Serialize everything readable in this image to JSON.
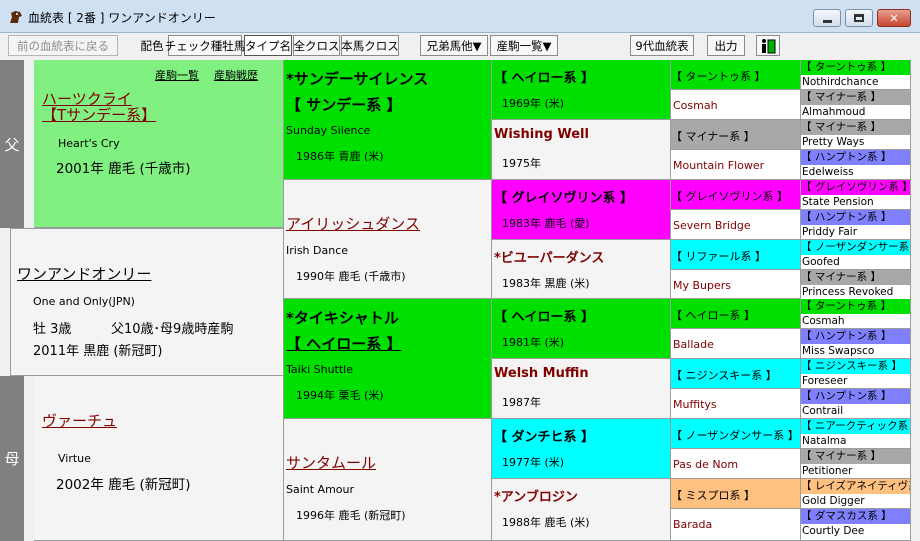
{
  "window": {
    "title": "血統表 [ 2番 ] ワンアンドオンリー"
  },
  "toolbar": {
    "back": "前の血統表に戻る",
    "color_label": "配色",
    "check_sire": "チェック種牡馬",
    "type_name": "タイプ名",
    "all_cross": "全クロス",
    "self_cross": "本馬クロス",
    "siblings": "兄弟馬他▼",
    "foals": "産駒一覧▼",
    "gen9": "9代血統表",
    "output": "出力"
  },
  "sections": {
    "father": "父",
    "mother": "母"
  },
  "sire": {
    "links": [
      "産駒一覧",
      "産駒戦歴"
    ],
    "name": "ハーツクライ",
    "line": "【Tサンデー系】",
    "eng": "Heart's Cry",
    "info": "2001年 鹿毛 (千歳市)"
  },
  "horse": {
    "name": "ワンアンドオンリー",
    "eng": "One and Only(JPN)",
    "detail1": "牡 3歳",
    "detail2": "父10歳･母9歳時産駒",
    "info": "2011年 黒鹿 (新冠町)"
  },
  "dam": {
    "name": "ヴァーチュ",
    "eng": "Virtue",
    "info": "2002年 鹿毛 (新冠町)"
  },
  "gen2": [
    {
      "name": "*サンデーサイレンス",
      "line": "【 サンデー系 】",
      "eng": "Sunday Silence",
      "info": "1986年 青鹿 (米)"
    },
    {
      "name": "アイリッシュダンス",
      "eng": "Irish Dance",
      "info": "1990年 鹿毛 (千歳市)"
    },
    {
      "name": "*タイキシャトル",
      "line": "【 ヘイロー系 】",
      "eng": "Taiki Shuttle",
      "info": "1994年 栗毛 (米)"
    },
    {
      "name": "サンタムール",
      "eng": "Saint Amour",
      "info": "1996年 鹿毛 (新冠町)"
    }
  ],
  "gen3": [
    {
      "line": "【 ヘイロー系 】",
      "info": "1969年 (米)"
    },
    {
      "name": "Wishing Well",
      "info": "1975年"
    },
    {
      "line": "【 グレイソヴリン系 】",
      "info": "1983年 鹿毛 (愛)"
    },
    {
      "name": "*ビユーパーダンス",
      "info": "1983年 黒鹿 (米)"
    },
    {
      "line": "【 ヘイロー系 】",
      "info": "1981年 (米)"
    },
    {
      "name": "Welsh Muffin",
      "info": "1987年"
    },
    {
      "line": "【 ダンチヒ系 】",
      "info": "1977年 (米)"
    },
    {
      "name": "*アンブロジン",
      "info": "1988年 鹿毛 (米)"
    }
  ],
  "gen4": [
    {
      "line": "【 ターントゥ系 】",
      "name": "Cosmah"
    },
    {
      "line": "【 マイナー系 】",
      "name": "Mountain Flower"
    },
    {
      "line": "【 グレイソヴリン系 】",
      "name": "Severn Bridge"
    },
    {
      "line": "【 リファール系 】",
      "name": "My Bupers"
    },
    {
      "line": "【 ヘイロー系 】",
      "name": "Ballade"
    },
    {
      "line": "【 ニジンスキー系 】",
      "name": "Muffitys"
    },
    {
      "line": "【 ノーザンダンサー系 】",
      "name": "Pas de Nom"
    },
    {
      "line": "【 ミスプロ系 】",
      "name": "Barada"
    }
  ],
  "gen5": [
    {
      "line": "【 ターントゥ系 】",
      "name": "Nothirdchance"
    },
    {
      "line": "【 マイナー系 】",
      "name": "Almahmoud"
    },
    {
      "line": "【 マイナー系 】",
      "name": "Pretty Ways"
    },
    {
      "line": "【 ハンプトン系 】",
      "name": "Edelweiss"
    },
    {
      "line": "【 グレイソヴリン系 】",
      "name": "State Pension"
    },
    {
      "line": "【 ハンプトン系 】",
      "name": "Priddy Fair"
    },
    {
      "line": "【 ノーザンダンサー系 】",
      "name": "Goofed"
    },
    {
      "line": "【 マイナー系 】",
      "name": "Princess Revoked"
    },
    {
      "line": "【 ターントゥ系 】",
      "name": "Cosmah"
    },
    {
      "line": "【 ハンプトン系 】",
      "name": "Miss Swapsco"
    },
    {
      "line": "【 ニジンスキー系 】",
      "name": "Foreseer"
    },
    {
      "line": "【 ハンプトン系 】",
      "name": "Contrail"
    },
    {
      "line": "【 ニアークティック系 】",
      "name": "Natalma"
    },
    {
      "line": "【 マイナー系 】",
      "name": "Petitioner"
    },
    {
      "line": "【 レイズアネイティヴ系 】",
      "name": "Gold Digger"
    },
    {
      "line": "【 ダマスカス系 】",
      "name": "Courtly Dee"
    }
  ],
  "colors": {
    "light_green": "#80f080",
    "green": "#00e000",
    "cyan": "#00ffff",
    "magenta": "#ff00ff",
    "orange": "#ffc080",
    "gray": "#a8a8a8",
    "blue": "#8080ff"
  }
}
